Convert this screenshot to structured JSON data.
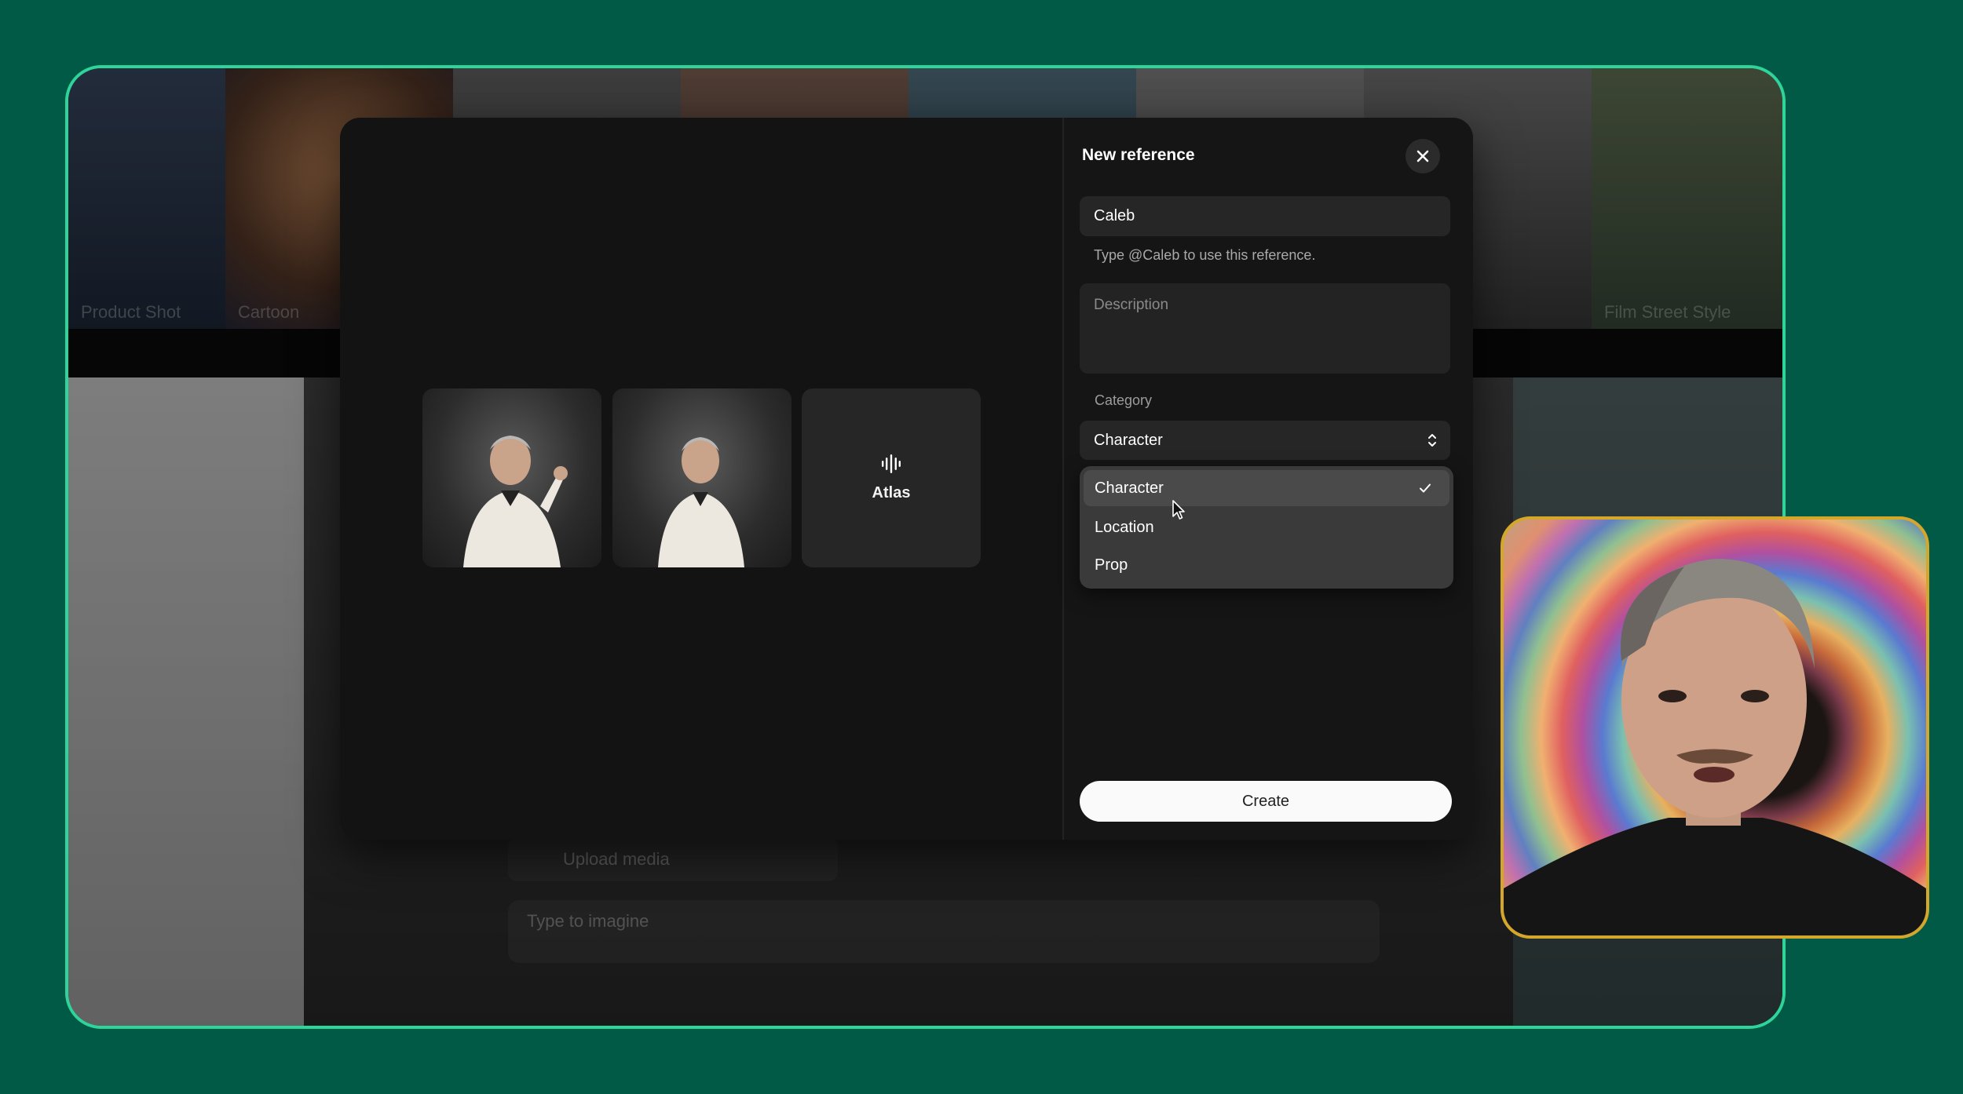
{
  "background": {
    "tiles_top": [
      {
        "caption": "Product Shot"
      },
      {
        "caption": "Cartoon"
      },
      {
        "caption": ""
      },
      {
        "caption": ""
      },
      {
        "caption": ""
      },
      {
        "caption": ""
      },
      {
        "caption": ""
      },
      {
        "caption": "Film Street Style"
      }
    ],
    "upload_label": "Upload media",
    "prompt_placeholder": "Type to imagine"
  },
  "modal": {
    "atlas_tile": {
      "label": "Atlas",
      "icon": "waveform-icon"
    },
    "thumbnails": [
      {
        "alt": "man in white jacket pointing"
      },
      {
        "alt": "man in white jacket standing"
      }
    ]
  },
  "panel": {
    "title": "New reference",
    "close_icon": "close-icon",
    "name_value": "Caleb",
    "name_hint": "Type @Caleb to use this reference.",
    "description_placeholder": "Description",
    "category_label": "Category",
    "category_selected": "Character",
    "category_options": [
      "Character",
      "Location",
      "Prop"
    ],
    "create_label": "Create"
  },
  "colors": {
    "page_bg": "#005a46",
    "frame_border": "#2fd49a",
    "webcam_border": "#d4a72a",
    "primary_button": "#fafafa"
  }
}
